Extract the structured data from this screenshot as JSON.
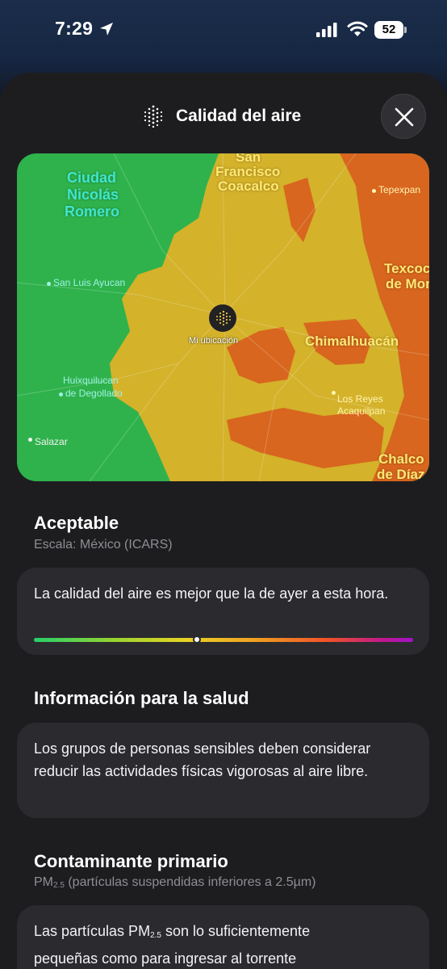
{
  "status_bar": {
    "time": "7:29",
    "battery": "52",
    "icons": [
      "location-arrow-icon",
      "cellular-signal-icon",
      "wifi-icon",
      "battery-icon"
    ]
  },
  "header": {
    "title": "Calidad del aire",
    "icon": "air-quality-icon",
    "close_icon": "close-icon"
  },
  "map": {
    "labels": {
      "ciudad_nicolas_romero_1": "Ciudad",
      "ciudad_nicolas_romero_2": "Nicolás",
      "ciudad_nicolas_romero_3": "Romero",
      "san_francisco_coacalco_1": "San",
      "san_francisco_coacalco_2": "Francisco",
      "san_francisco_coacalco_3": "Coacalco",
      "tepexpan": "Tepexpan",
      "texcoco_1": "Texcoco",
      "texcoco_2": "de Mor",
      "san_luis_ayucan": "San Luis Ayucan",
      "chimalhuacan": "Chimalhuacán",
      "huixquilucan_1": "Huixquilucan",
      "huixquilucan_2": "de Degollado",
      "los_reyes_1": "Los Reyes",
      "los_reyes_2": "Acaquilpan",
      "salazar": "Salazar",
      "chalco_1": "Chalco",
      "chalco_2": "de Díaz"
    },
    "my_location_label": "Mi ubicación",
    "colors": {
      "good": "#2fb24c",
      "moderate": "#d4b22a",
      "bad": "#d8661e"
    }
  },
  "status": {
    "level": "Aceptable",
    "scale": "Escala: México (ICARS)",
    "comparison": "La calidad del aire es mejor que la de ayer a esta hora.",
    "bar_position_fraction": 0.43
  },
  "health": {
    "title": "Información para la salud",
    "text": "Los grupos de personas sensibles deben considerar reducir las actividades físicas vigorosas al aire libre."
  },
  "pollutant": {
    "title": "Contaminante primario",
    "name_prefix": "PM",
    "name_sub": "2.5",
    "name_desc": " (partículas suspendidas inferiores a 2.5µm)",
    "text_prefix": "Las partículas PM",
    "text_sub": "2.5",
    "text_line1_suffix": " son lo suficientemente",
    "text_line2": "pequeñas como para ingresar al torrente"
  }
}
